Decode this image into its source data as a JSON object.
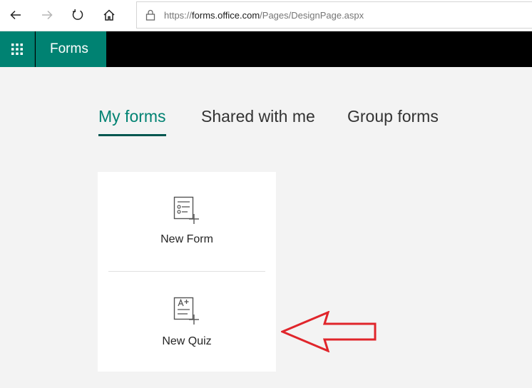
{
  "browser": {
    "url_prefix": "https://",
    "url_host": "forms.office.com",
    "url_path": "/Pages/DesignPage.aspx",
    "icons": [
      "back-arrow-icon",
      "forward-arrow-icon",
      "refresh-icon",
      "home-icon",
      "lock-icon"
    ]
  },
  "app_bar": {
    "brand": "Forms",
    "icon": "waffle-icon",
    "accent_color": "#008272"
  },
  "tabs": [
    {
      "label": "My forms",
      "active": true
    },
    {
      "label": "Shared with me",
      "active": false
    },
    {
      "label": "Group forms",
      "active": false
    }
  ],
  "create_card": {
    "items": [
      {
        "label": "New Form",
        "icon": "new-form-icon"
      },
      {
        "label": "New Quiz",
        "icon": "new-quiz-icon"
      }
    ]
  },
  "annotation": {
    "type": "arrow-left",
    "color": "#e0252b"
  }
}
